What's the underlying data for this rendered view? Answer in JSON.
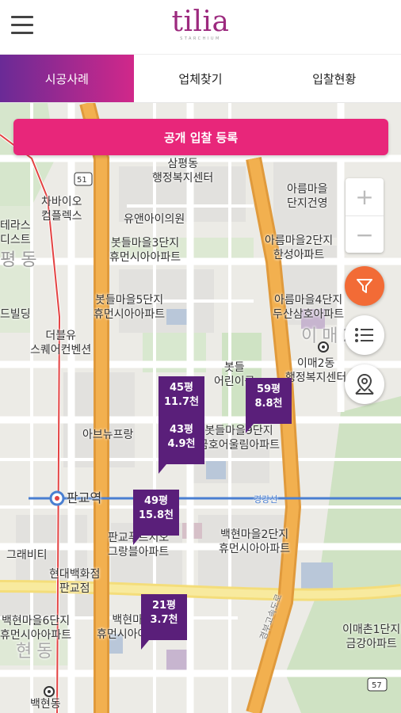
{
  "header": {
    "logo": "tilia",
    "logo_sub": "STARCHIUM"
  },
  "tabs": [
    {
      "label": "시공사례"
    },
    {
      "label": "업체찾기"
    },
    {
      "label": "입찰현황"
    }
  ],
  "register_button": "공개 입찰 등록",
  "zoom": {
    "plus": "+",
    "minus": "−"
  },
  "map_labels": {
    "samping": "삼평동",
    "samping2": "행정복지센터",
    "chabio1": "차바이오",
    "chabio2": "컴플렉스",
    "uaniclinic": "유앤아이의원",
    "areum_top1": "아름마을",
    "areum_top2": "단지건영",
    "areum2_1": "아름마을2단지",
    "areum2_2": "한성아파트",
    "botdeul3_1": "봇들마을3단지",
    "botdeul3_2": "휴먼시아아파트",
    "left1": "테라스",
    "left2": "디스트",
    "pyeongdong": "평동",
    "building": "드빌딩",
    "botdeul5_1": "봇들마을5단지",
    "botdeul5_2": "휴먼시아아파트",
    "areum4_1": "아름마을4단지",
    "areum4_2": "두산삼호아파트",
    "thebleu1": "더블유",
    "thebleu2": "스퀘어컨벤션",
    "park1": "봇들",
    "park2": "어린이공",
    "imae1": "이매2동",
    "imae2": "행정복지센터",
    "imae_big": "이매2",
    "abnew": "아브뉴프랑",
    "botdeul9_1": "봇들마을9단지",
    "botdeul9_2": "금호어울림아파트",
    "pangyo_station": "판교역",
    "gyeonggang": "경강선",
    "grabity": "그래비티",
    "hyundai1": "현대백화점",
    "hyundai2": "판교점",
    "pangyo_grand1": "판교푸르지오",
    "pangyo_grand2": "그랑블아파트",
    "baekhyun2_1": "백현마을2단지",
    "baekhyun2_2": "휴먼시아아파트",
    "baekhyun6_1": "백현마을6단지",
    "baekhyun6_2": "휴먼시아아파트",
    "baekhyun_mid1": "백현마을",
    "baekhyun_mid2": "휴먼시아아파트",
    "baekhyundong": "백현동",
    "baekhyundong_big": "현동",
    "imaechon1": "이매촌1단지",
    "imaechon2": "금강아파트",
    "highway": "경부고속도로",
    "road51": "51",
    "road57": "57"
  },
  "pins": [
    {
      "size": "45평",
      "price": "11.7천"
    },
    {
      "size": "59평",
      "price": "8.8천"
    },
    {
      "size": "43평",
      "price": "4.9천"
    },
    {
      "size": "49평",
      "price": "15.8천"
    },
    {
      "size": "21평",
      "price": "3.7천"
    }
  ],
  "colors": {
    "accent": "#e8267a",
    "pin": "#5a1f7a",
    "filter": "#f26b36",
    "tab_gradient_start": "#6a2a96",
    "tab_gradient_end": "#d1288a"
  }
}
